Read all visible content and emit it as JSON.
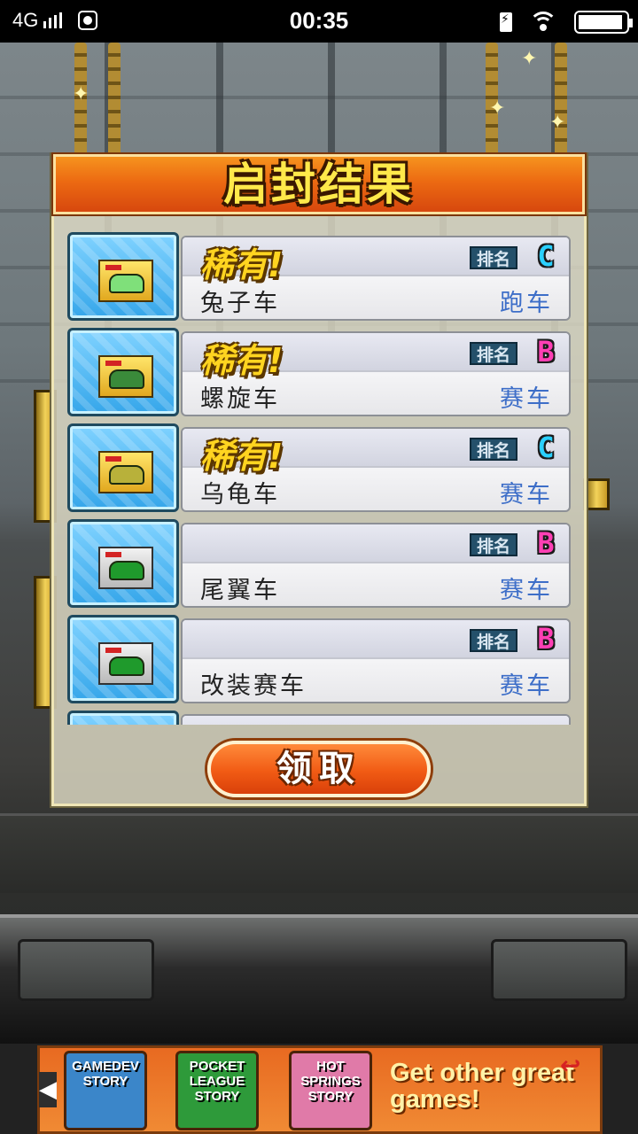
{
  "status_bar": {
    "network": "4G",
    "time": "00:35",
    "battery_level": 0.95,
    "icons": [
      "signal-icon",
      "browser-icon",
      "charging-icon",
      "wifi-icon",
      "battery-icon"
    ]
  },
  "dialog": {
    "title": "启封结果",
    "claim_label": "领取",
    "rank_label": "排名",
    "items": [
      {
        "rare": "稀有!",
        "name": "兔子车",
        "type": "跑车",
        "rank": "C",
        "rank_color": "#2ad0ff",
        "box": "gold",
        "car_color": "#7fe07a"
      },
      {
        "rare": "稀有!",
        "name": "螺旋车",
        "type": "赛车",
        "rank": "B",
        "rank_color": "#ff3fb4",
        "box": "gold",
        "car_color": "#3a8a3a"
      },
      {
        "rare": "稀有!",
        "name": "乌龟车",
        "type": "赛车",
        "rank": "C",
        "rank_color": "#2ad0ff",
        "box": "gold",
        "car_color": "#b8b13a"
      },
      {
        "rare": "",
        "name": "尾翼车",
        "type": "赛车",
        "rank": "B",
        "rank_color": "#ff3fb4",
        "box": "grey",
        "car_color": "#1f9a2c"
      },
      {
        "rare": "",
        "name": "改装赛车",
        "type": "赛车",
        "rank": "B",
        "rank_color": "#ff3fb4",
        "box": "grey",
        "car_color": "#1f9a2c"
      }
    ]
  },
  "ad": {
    "games": [
      {
        "title": "GAMEDEV STORY",
        "bg": "#3b86c9"
      },
      {
        "title": "POCKET LEAGUE STORY",
        "bg": "#2e9a3a"
      },
      {
        "title": "HOT SPRINGS STORY",
        "bg": "#e07aa8"
      }
    ],
    "cta": "Get other great games!"
  }
}
